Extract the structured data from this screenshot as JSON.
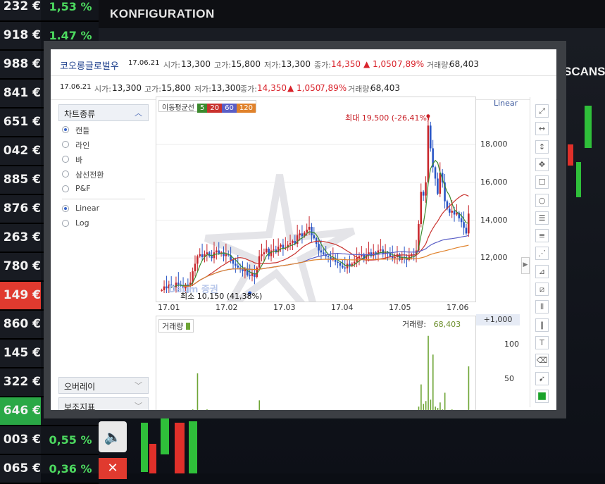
{
  "background": {
    "left_prices": [
      "232 €",
      "918 €",
      "988 €",
      "841 €",
      "651 €",
      "042 €",
      "885 €",
      "876 €",
      "263 €",
      "780 €",
      "149 €",
      "860 €",
      "145 €",
      "322 €",
      "646 €",
      "003 €",
      "065 €"
    ],
    "left_pcts": [
      "1,53 %",
      "1.47 %",
      "",
      "",
      "",
      "",
      "",
      "",
      "",
      "",
      "",
      "",
      "",
      "",
      "",
      "0,55 %",
      "0,36 %"
    ],
    "title": "KONFIGURATION",
    "scans_label": "SCANS",
    "price_colors": {
      "red": "#e03a2f",
      "green": "#2aa846"
    }
  },
  "header1": {
    "name": "코오롱글로벌우",
    "date": "17.06.21",
    "open_label": "시가:",
    "open": "13,300",
    "high_label": "고가:",
    "high": "15,800",
    "low_label": "저가:",
    "low": "13,300",
    "close_label": "종가:",
    "close": "14,350",
    "change": "▲ 1,050",
    "change_pct": "7,89%",
    "volume_label": "거래량:",
    "volume": "68,403"
  },
  "header2": {
    "date": "17.06.21",
    "open_label": "시가:",
    "open": "13,300",
    "high_label": "고가:",
    "high": "15,800",
    "low_label": "저가:",
    "low": "13,300",
    "close_label": "종가:",
    "close": "14,350",
    "change": "▲ 1,050",
    "change_pct": "7,89%",
    "volume_label": "거래량:",
    "volume": "68,403"
  },
  "sidebar": {
    "chart_type_title": "차트종류",
    "chart_types": [
      "캔들",
      "라인",
      "바",
      "삼선전환",
      "P&F"
    ],
    "selected_chart_type": "캔들",
    "scales": [
      "Linear",
      "Log"
    ],
    "selected_scale": "Linear",
    "overlay_title": "오버레이",
    "indicator_title": "보조지표"
  },
  "legend": {
    "ma_label": "이동평균선",
    "periods": [
      "5",
      "20",
      "60",
      "120"
    ],
    "colors": [
      "#3c8a2e",
      "#c9322e",
      "#5a5ec6",
      "#e0822b"
    ]
  },
  "scale_label": "Linear",
  "max_label": "최대  19,500  (-26,41%)",
  "min_label": "최소  10,150  (41,38%)",
  "watermark": "Daum 증권",
  "volume_panel": {
    "legend": "거래량",
    "readout_label": "거래량:",
    "readout_value": "68,403",
    "multiplier": "+1,000"
  },
  "toolbar_icons": [
    "line-tool-icon",
    "horizontal-arrow-icon",
    "vertical-arrow-icon",
    "crosshair-icon",
    "rectangle-icon",
    "circle-icon",
    "fibonacci-retracement-icon",
    "fibonacci-fan-icon",
    "fibonacci-arc-icon",
    "gann-fan-icon",
    "speed-line-icon",
    "cycle-lines-icon",
    "parallel-lines-icon",
    "text-tool-icon",
    "eraser-icon",
    "pointer-icon",
    "color-picker-icon"
  ],
  "chart_data": {
    "type": "candlestick",
    "title": "",
    "x_ticks": [
      "17,01",
      "17,02",
      "17,03",
      "17,04",
      "17,05",
      "17,06"
    ],
    "y_ticks": [
      12000,
      14000,
      16000,
      18000
    ],
    "ylim": [
      10000,
      20200
    ],
    "scale": "linear",
    "annotations": {
      "max": {
        "value": 19500,
        "label": "최대 19,500 (-26,41%)"
      },
      "min": {
        "value": 10150,
        "label": "최소 10,150 (41,38%)"
      }
    },
    "close": [
      10300,
      10500,
      10400,
      10600,
      10500,
      10450,
      10700,
      10600,
      10550,
      10400,
      10600,
      10500,
      10700,
      11300,
      11700,
      12100,
      12200,
      12050,
      12200,
      12300,
      12100,
      12000,
      12300,
      12400,
      12250,
      12300,
      12100,
      12200,
      12150,
      11900,
      11700,
      11600,
      11500,
      11400,
      11300,
      11450,
      11100,
      11050,
      11200,
      11000,
      11500,
      12100,
      12200,
      12300,
      12500,
      12100,
      12400,
      12450,
      12300,
      12600,
      12700,
      12500,
      12550,
      12700,
      12800,
      12900,
      12750,
      13200,
      13300,
      13150,
      13350,
      13500,
      13650,
      13200,
      13050,
      12750,
      12400,
      12300,
      12200,
      12100,
      12050,
      11900,
      12000,
      11800,
      11750,
      11600,
      11500,
      11450,
      11700,
      11600,
      11700,
      11800,
      12000,
      12100,
      12200,
      11950,
      12200,
      12300,
      12100,
      12300,
      12200,
      12400,
      12450,
      12200,
      12300,
      12250,
      12100,
      12000,
      12050,
      12200,
      11900,
      12050,
      12000,
      11900,
      12100,
      12200,
      12150,
      12400,
      13800,
      15500,
      15300,
      16000,
      19000,
      17800,
      16800,
      16200,
      15400,
      16500,
      16000,
      15000,
      14600,
      14400,
      14500,
      14300,
      14400,
      14100,
      13900,
      13600,
      13300,
      14350
    ],
    "ma_periods": [
      5,
      20,
      60,
      120
    ],
    "volume": {
      "unit_multiplier": "+1,000",
      "y_ticks": [
        50,
        100
      ],
      "values": [
        4,
        3,
        3,
        5,
        4,
        2,
        3,
        2,
        3,
        2,
        4,
        2,
        3,
        6,
        5,
        58,
        2,
        3,
        4,
        6,
        2,
        3,
        3,
        4,
        2,
        3,
        2,
        2,
        3,
        2,
        2,
        1,
        2,
        1,
        2,
        3,
        1,
        2,
        3,
        1,
        2,
        19,
        2,
        3,
        4,
        2,
        3,
        2,
        3,
        2,
        3,
        2,
        2,
        3,
        2,
        3,
        2,
        2,
        3,
        2,
        2,
        3,
        3,
        2,
        2,
        2,
        2,
        2,
        1,
        2,
        1,
        2,
        2,
        1,
        1,
        2,
        1,
        1,
        2,
        1,
        2,
        2,
        3,
        2,
        2,
        1,
        2,
        2,
        1,
        2,
        2,
        2,
        2,
        1,
        2,
        2,
        1,
        1,
        2,
        2,
        1,
        2,
        1,
        1,
        2,
        2,
        1,
        3,
        10,
        42,
        14,
        18,
        112,
        20,
        85,
        10,
        8,
        16,
        6,
        30,
        5,
        4,
        6,
        3,
        4,
        3,
        3,
        4,
        3,
        68
      ],
      "latest": 68403
    }
  }
}
